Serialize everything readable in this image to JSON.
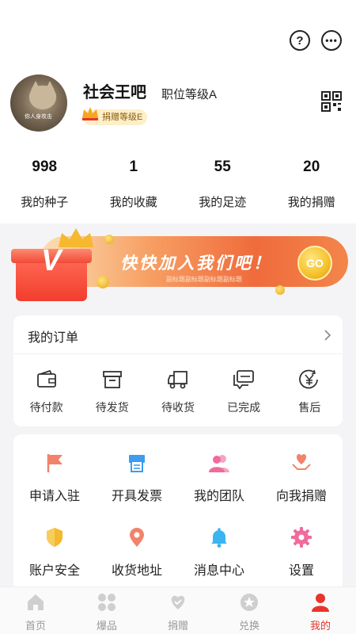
{
  "header": {
    "help_icon": "question-circle-icon",
    "message_icon": "chat-bubble-icon"
  },
  "profile": {
    "name": "社会王吧",
    "level": "职位等级A",
    "donate_badge": "捐赠等级E",
    "avatar_text": "你人身攻击",
    "qr_icon": "qr-code-icon"
  },
  "stats": [
    {
      "value": "998",
      "label": "我的种子"
    },
    {
      "value": "1",
      "label": "我的收藏"
    },
    {
      "value": "55",
      "label": "我的足迹"
    },
    {
      "value": "20",
      "label": "我的捐赠"
    }
  ],
  "banner": {
    "title": "快快加入我们吧！",
    "subtitle": "副标题副标题副标题副标题",
    "go_label": "GO",
    "logo_letter": "V"
  },
  "orders": {
    "header": "我的订单",
    "items": [
      {
        "label": "待付款",
        "icon": "wallet-icon"
      },
      {
        "label": "待发货",
        "icon": "package-icon"
      },
      {
        "label": "待收货",
        "icon": "truck-icon"
      },
      {
        "label": "已完成",
        "icon": "message-check-icon"
      },
      {
        "label": "售后",
        "icon": "yen-refund-icon"
      }
    ]
  },
  "services": [
    {
      "label": "申请入驻",
      "icon": "flag-icon",
      "color": "#f2836b"
    },
    {
      "label": "开具发票",
      "icon": "printer-icon",
      "color": "#3b9cf0"
    },
    {
      "label": "我的团队",
      "icon": "team-icon",
      "color": "#f06a9b"
    },
    {
      "label": "向我捐赠",
      "icon": "heart-hand-icon",
      "color": "#f2836b"
    },
    {
      "label": "账户安全",
      "icon": "shield-icon",
      "color": "#f5b82e"
    },
    {
      "label": "收货地址",
      "icon": "location-pin-icon",
      "color": "#f2836b"
    },
    {
      "label": "消息中心",
      "icon": "bell-icon",
      "color": "#3bb4f0"
    },
    {
      "label": "设置",
      "icon": "gear-icon",
      "color": "#f06a9b"
    }
  ],
  "tabbar": [
    {
      "label": "首页",
      "icon": "home-icon",
      "active": false
    },
    {
      "label": "爆品",
      "icon": "grid-icon",
      "active": false
    },
    {
      "label": "捐赠",
      "icon": "donate-heart-icon",
      "active": false
    },
    {
      "label": "兑换",
      "icon": "exchange-star-icon",
      "active": false
    },
    {
      "label": "我的",
      "icon": "user-icon",
      "active": true
    }
  ],
  "colors": {
    "accent": "#e8342c",
    "inactive_tab": "#999999",
    "banner_orange": "#f06b3c"
  }
}
